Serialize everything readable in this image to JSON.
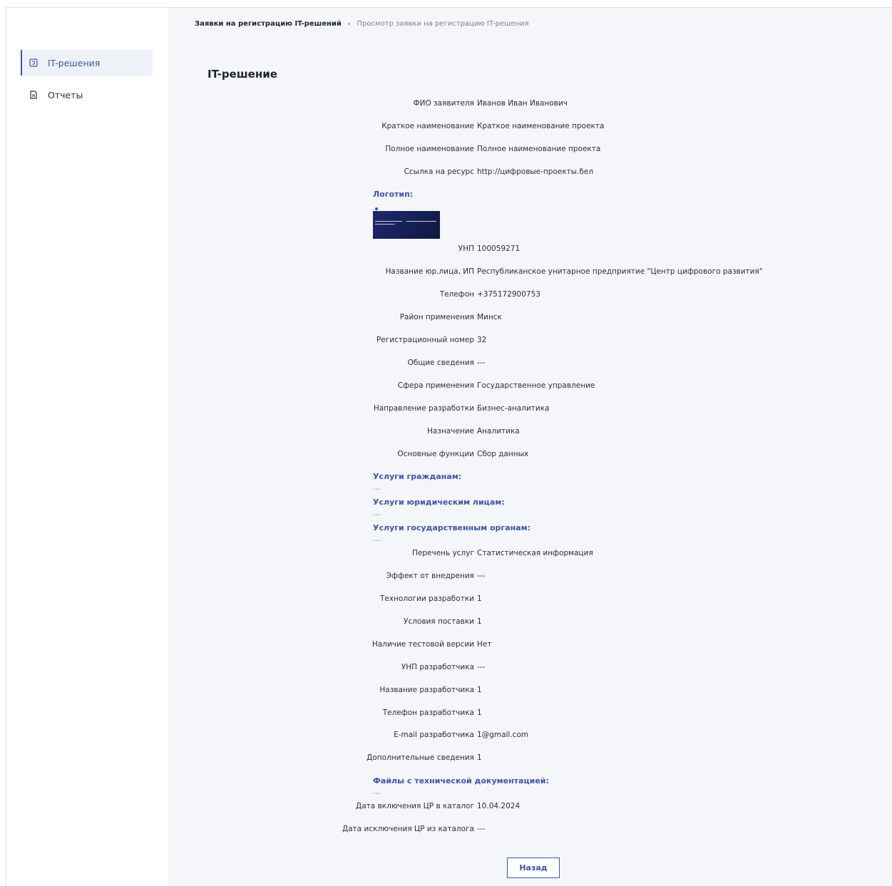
{
  "sidebar": {
    "items": [
      {
        "label": "IT-решения",
        "icon": "box-icon"
      },
      {
        "label": "Отчеты",
        "icon": "document-icon"
      }
    ]
  },
  "breadcrumb": {
    "parent": "Заявки на регистрацию IT-решений",
    "separator": "›",
    "current": "Просмотр заявки на регистрацию IT-решения"
  },
  "page_title": "IT-решение",
  "fields": {
    "applicant": {
      "label": "ФИО заявителя",
      "value": "Иванов Иван Иванович"
    },
    "short_name": {
      "label": "Краткое наименование",
      "value": "Краткое наименование проекта"
    },
    "full_name": {
      "label": "Полное наименование",
      "value": "Полное наименование проекта"
    },
    "resource_link": {
      "label": "Ссылка на ресурс",
      "value": "http://цифровые-проекты.бел"
    },
    "unp": {
      "label": "УНП",
      "value": "100059271"
    },
    "legal_name": {
      "label": "Название юр.лица, ИП",
      "value": "Республиканское унитарное предприятие \"Центр цифрового развития\""
    },
    "phone": {
      "label": "Телефон",
      "value": "+375172900753"
    },
    "district": {
      "label": "Район применения",
      "value": "Минск"
    },
    "reg_number": {
      "label": "Регистрационный номер",
      "value": "32"
    },
    "general_info": {
      "label": "Общие сведения",
      "value": "---"
    },
    "sphere": {
      "label": "Сфера применения",
      "value": "Государственное управление"
    },
    "direction": {
      "label": "Направление разработки",
      "value": "Бизнес-аналитика"
    },
    "purpose": {
      "label": "Назначение",
      "value": "Аналитика"
    },
    "main_functions": {
      "label": "Основные функции",
      "value": "Сбор данных"
    },
    "services_list": {
      "label": "Перечень услуг",
      "value": "Статистическая информация"
    },
    "effect": {
      "label": "Эффект от внедрения",
      "value": "---"
    },
    "technologies": {
      "label": "Технологии разработки",
      "value": "1"
    },
    "delivery": {
      "label": "Условия поставки",
      "value": "1"
    },
    "test_version": {
      "label": "Наличие тестовой версии",
      "value": "Нет"
    },
    "dev_unp": {
      "label": "УНП разработчика",
      "value": "---"
    },
    "dev_name": {
      "label": "Название разработчика",
      "value": "1"
    },
    "dev_phone": {
      "label": "Телефон разработчика",
      "value": "1"
    },
    "dev_email": {
      "label": "E-mail разработчика",
      "value": "1@gmail.com"
    },
    "additional": {
      "label": "Дополнительные сведения",
      "value": "1"
    },
    "catalog_in": {
      "label": "Дата включения ЦР в каталог",
      "value": "10.04.2024"
    },
    "catalog_out": {
      "label": "Дата исключения ЦР из каталога",
      "value": "---"
    }
  },
  "sections": {
    "logo": {
      "title": "Логотип:"
    },
    "citizens": {
      "title": "Услуги гражданам:",
      "value": "---"
    },
    "legal": {
      "title": "Услуги юридическим лицам:",
      "value": "---"
    },
    "government": {
      "title": "Услуги государственным органам:",
      "value": "---"
    },
    "files": {
      "title": "Файлы с технической документацией:",
      "value": "---"
    }
  },
  "back_button": {
    "label": "Назад"
  }
}
